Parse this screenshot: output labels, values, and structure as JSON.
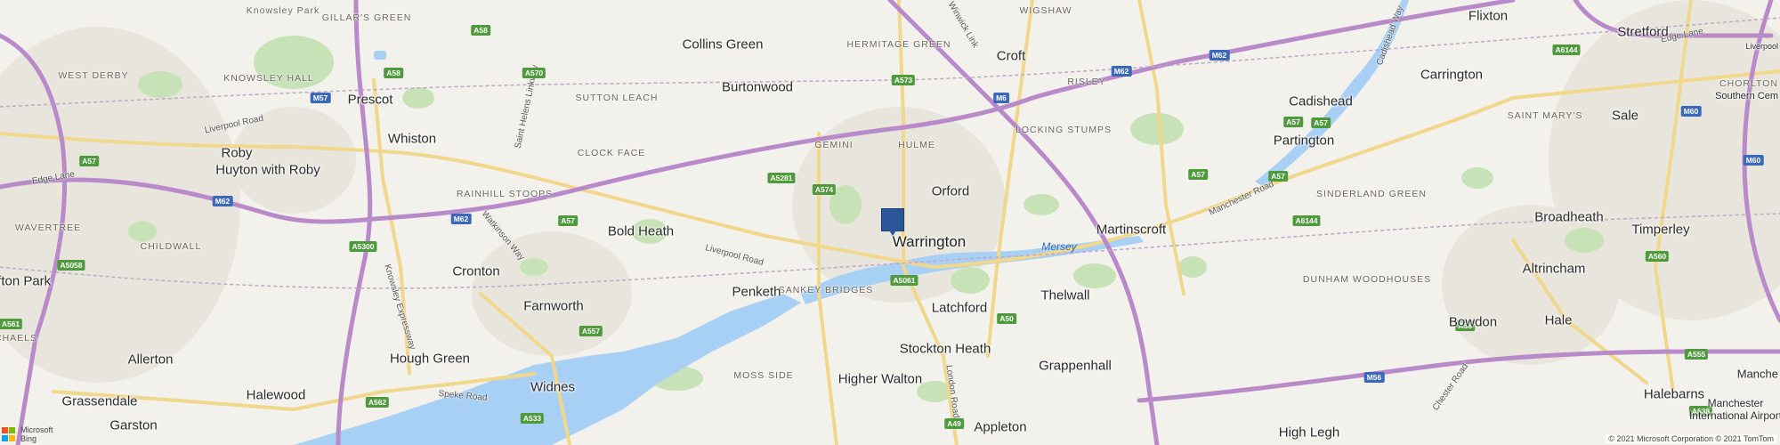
{
  "colors": {
    "land": "#f2f1ec",
    "urban": "#e9e7de",
    "park": "#c4e0b4",
    "water": "#a8d0f5",
    "motorway": "#b88ac9",
    "a_road": "#f0d78c",
    "pin": "#2a5599"
  },
  "pin": {
    "name": "Warrington"
  },
  "towns": [
    {
      "id": "collins-green",
      "name": "Collins Green"
    },
    {
      "id": "croft",
      "name": "Croft"
    },
    {
      "id": "flixton",
      "name": "Flixton"
    },
    {
      "id": "stretford",
      "name": "Stretford"
    },
    {
      "id": "prescot",
      "name": "Prescot"
    },
    {
      "id": "burtonwood",
      "name": "Burtonwood"
    },
    {
      "id": "carrington",
      "name": "Carrington"
    },
    {
      "id": "cadishead",
      "name": "Cadishead"
    },
    {
      "id": "whiston",
      "name": "Whiston"
    },
    {
      "id": "partington",
      "name": "Partington"
    },
    {
      "id": "sale",
      "name": "Sale"
    },
    {
      "id": "roby",
      "name": "Roby"
    },
    {
      "id": "huyton",
      "name": "Huyton with Roby"
    },
    {
      "id": "orford",
      "name": "Orford"
    },
    {
      "id": "bold-heath",
      "name": "Bold Heath"
    },
    {
      "id": "warrington",
      "name": "Warrington"
    },
    {
      "id": "martinscroft",
      "name": "Martinscroft"
    },
    {
      "id": "broadheath",
      "name": "Broadheath"
    },
    {
      "id": "timperley",
      "name": "Timperley"
    },
    {
      "id": "cronton",
      "name": "Cronton"
    },
    {
      "id": "altrincham",
      "name": "Altrincham"
    },
    {
      "id": "sefton-park",
      "name": "Sefton Park"
    },
    {
      "id": "penketh",
      "name": "Penketh"
    },
    {
      "id": "latchford",
      "name": "Latchford"
    },
    {
      "id": "thelwall",
      "name": "Thelwall"
    },
    {
      "id": "farnworth",
      "name": "Farnworth"
    },
    {
      "id": "hale",
      "name": "Hale"
    },
    {
      "id": "bowdon",
      "name": "Bowdon"
    },
    {
      "id": "allerton",
      "name": "Allerton"
    },
    {
      "id": "hough-green",
      "name": "Hough Green"
    },
    {
      "id": "stockton-heath",
      "name": "Stockton Heath"
    },
    {
      "id": "grappenhall",
      "name": "Grappenhall"
    },
    {
      "id": "higher-walton",
      "name": "Higher Walton"
    },
    {
      "id": "halebarns",
      "name": "Halebarns"
    },
    {
      "id": "widnes",
      "name": "Widnes"
    },
    {
      "id": "grassendale",
      "name": "Grassendale"
    },
    {
      "id": "halewood",
      "name": "Halewood"
    },
    {
      "id": "garston",
      "name": "Garston"
    },
    {
      "id": "appleton",
      "name": "Appleton"
    },
    {
      "id": "high-legh",
      "name": "High Legh"
    },
    {
      "id": "manchester-airport",
      "name": "Manchester International Airport"
    },
    {
      "id": "liverpool",
      "name": "Liverpool"
    },
    {
      "id": "southern-cem",
      "name": "Southern Cem"
    },
    {
      "id": "chorlton",
      "name": "CHORLTON"
    },
    {
      "id": "manchester",
      "name": "Manche"
    }
  ],
  "localities": [
    {
      "id": "knowsley-park",
      "name": "Knowsley Park"
    },
    {
      "id": "gillars-green",
      "name": "GILLAR'S GREEN"
    },
    {
      "id": "hermitage-green",
      "name": "HERMITAGE GREEN"
    },
    {
      "id": "wigshaw",
      "name": "WIGSHAW"
    },
    {
      "id": "west-derby",
      "name": "WEST DERBY"
    },
    {
      "id": "knowsley-hall",
      "name": "KNOWSLEY HALL"
    },
    {
      "id": "sutton-leach",
      "name": "SUTTON LEACH"
    },
    {
      "id": "risley",
      "name": "RISLEY"
    },
    {
      "id": "locking-stumps",
      "name": "LOCKING STUMPS"
    },
    {
      "id": "saint-marys",
      "name": "SAINT MARY'S"
    },
    {
      "id": "gemini",
      "name": "GEMINI"
    },
    {
      "id": "hulme",
      "name": "HULME"
    },
    {
      "id": "clock-face",
      "name": "CLOCK FACE"
    },
    {
      "id": "rainhill-stoops",
      "name": "RAINHILL STOOPS"
    },
    {
      "id": "sinderland-green",
      "name": "SINDERLAND GREEN"
    },
    {
      "id": "wavertree",
      "name": "WAVERTREE"
    },
    {
      "id": "childwall",
      "name": "CHILDWALL"
    },
    {
      "id": "dunham-woodhouses",
      "name": "DUNHAM WOODHOUSES"
    },
    {
      "id": "sankey-bridges",
      "name": "SANKEY BRIDGES"
    },
    {
      "id": "moss-side",
      "name": "MOSS SIDE"
    },
    {
      "id": "chaels",
      "name": "CHAELS"
    }
  ],
  "water_labels": [
    {
      "id": "mersey",
      "name": "Mersey"
    }
  ],
  "road_labels": [
    {
      "id": "liverpool-road-1",
      "name": "Liverpool Road"
    },
    {
      "id": "liverpool-road-2",
      "name": "Liverpool Road"
    },
    {
      "id": "edge-lane-1",
      "name": "Edge Lane"
    },
    {
      "id": "edge-lane-2",
      "name": "Edge Lane"
    },
    {
      "id": "saint-helens-linkway",
      "name": "Saint Helens Linkway"
    },
    {
      "id": "warkinson-way",
      "name": "Watkinson Way"
    },
    {
      "id": "knowsley-expressway",
      "name": "Knowsley Expressway"
    },
    {
      "id": "speke-road",
      "name": "Speke Road"
    },
    {
      "id": "london-road",
      "name": "London Road"
    },
    {
      "id": "manchester-road",
      "name": "Manchester Road"
    },
    {
      "id": "winwick-link",
      "name": "Winwick Link"
    },
    {
      "id": "chester-road",
      "name": "Chester Road"
    },
    {
      "id": "cadishead-way",
      "name": "Cadishead Way"
    }
  ],
  "shields": [
    {
      "id": "a58-1",
      "name": "A58",
      "kind": "a"
    },
    {
      "id": "a570",
      "name": "A570",
      "kind": "a"
    },
    {
      "id": "a573",
      "name": "A573",
      "kind": "a"
    },
    {
      "id": "m6",
      "name": "M6",
      "kind": "m"
    },
    {
      "id": "m62-1",
      "name": "M62",
      "kind": "m"
    },
    {
      "id": "m62-2",
      "name": "M62",
      "kind": "m"
    },
    {
      "id": "a6144-1",
      "name": "A6144",
      "kind": "a"
    },
    {
      "id": "a58-2",
      "name": "A58",
      "kind": "a"
    },
    {
      "id": "m57",
      "name": "M57",
      "kind": "m"
    },
    {
      "id": "a57-1",
      "name": "A57",
      "kind": "a"
    },
    {
      "id": "m60-1",
      "name": "M60",
      "kind": "m"
    },
    {
      "id": "a5281",
      "name": "A5281",
      "kind": "a"
    },
    {
      "id": "a574",
      "name": "A574",
      "kind": "a"
    },
    {
      "id": "a57-2",
      "name": "A57",
      "kind": "a"
    },
    {
      "id": "m60-2",
      "name": "M60",
      "kind": "m"
    },
    {
      "id": "m62-3",
      "name": "M62",
      "kind": "m"
    },
    {
      "id": "m62-4",
      "name": "M62",
      "kind": "m"
    },
    {
      "id": "a57-3",
      "name": "A57",
      "kind": "a"
    },
    {
      "id": "a57-4",
      "name": "A57",
      "kind": "a"
    },
    {
      "id": "a6144-2",
      "name": "A6144",
      "kind": "a"
    },
    {
      "id": "a5300",
      "name": "A5300",
      "kind": "a"
    },
    {
      "id": "a5058",
      "name": "A5058",
      "kind": "a"
    },
    {
      "id": "a560",
      "name": "A560",
      "kind": "a"
    },
    {
      "id": "a5061",
      "name": "A5061",
      "kind": "a"
    },
    {
      "id": "a50",
      "name": "A50",
      "kind": "a"
    },
    {
      "id": "a561",
      "name": "A561",
      "kind": "a"
    },
    {
      "id": "a557",
      "name": "A557",
      "kind": "a"
    },
    {
      "id": "a56",
      "name": "A56",
      "kind": "a"
    },
    {
      "id": "m56",
      "name": "M56",
      "kind": "m"
    },
    {
      "id": "a555",
      "name": "A555",
      "kind": "a"
    },
    {
      "id": "a562",
      "name": "A562",
      "kind": "a"
    },
    {
      "id": "a533",
      "name": "A533",
      "kind": "a"
    },
    {
      "id": "a49",
      "name": "A49",
      "kind": "a"
    },
    {
      "id": "a538",
      "name": "A538",
      "kind": "a"
    },
    {
      "id": "a57-5",
      "name": "A57",
      "kind": "a"
    },
    {
      "id": "a57-6",
      "name": "A57",
      "kind": "a"
    }
  ],
  "logo": {
    "brand_line1": "Microsoft",
    "brand_line2": "Bing"
  },
  "copyright": "© 2021 Microsoft Corporation © 2021 TomTom"
}
